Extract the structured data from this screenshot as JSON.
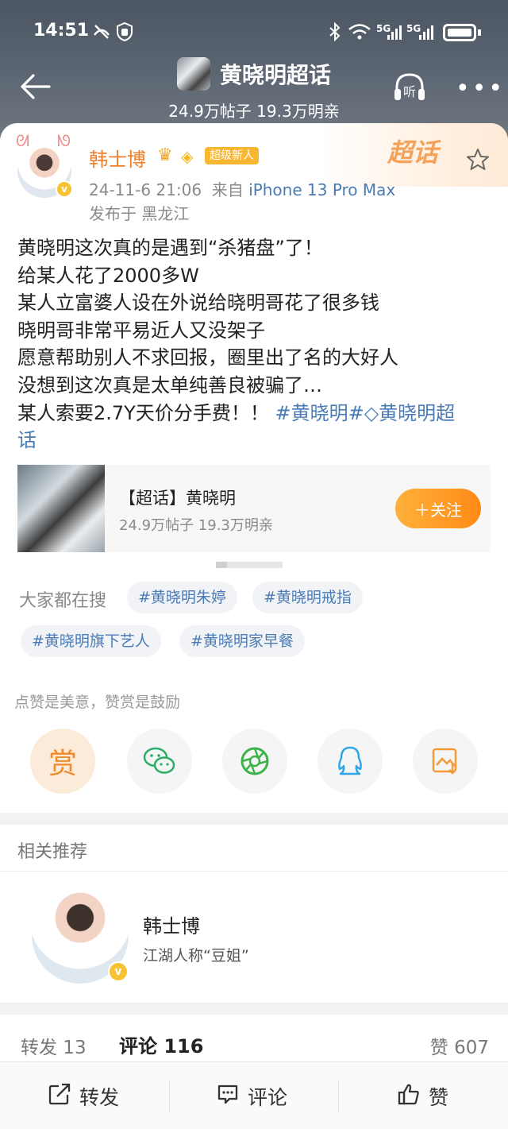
{
  "status_bar": {
    "time": "14:51",
    "network1": "5G",
    "network2": "5G"
  },
  "header": {
    "title": "黄晓明超话",
    "subtitle": "24.9万帖子 19.3万明亲",
    "listen_label": "听"
  },
  "post": {
    "badge": "超话",
    "author": "韩士博",
    "level_badge": "超级新人",
    "date": "24-11-6 21:06",
    "source_prefix": "来自",
    "device": "iPhone 13 Pro Max",
    "location": "发布于 黑龙江",
    "lines": [
      "黄晓明这次真的是遇到“杀猪盘”了！",
      "给某人花了2000多W",
      "某人立富婆人设在外说给晓明哥花了很多钱",
      "晓明哥非常平易近人又没架子",
      "愿意帮助别人不求回报，圈里出了名的大好人",
      "没想到这次真是太单纯善良被骗了…",
      "某人索要2.7Y天价分手费！！"
    ],
    "tag1": "#黄晓明#",
    "tag2": "黄晓明超",
    "tag2_cont": "话"
  },
  "topic_card": {
    "title": "【超话】黄晓明",
    "subtitle": "24.9万帖子 19.3万明亲",
    "follow_label": "＋关注"
  },
  "search": {
    "label": "大家都在搜",
    "chips": [
      "#黄晓明朱婷",
      "#黄晓明戒指",
      "#黄晓明旗下艺人",
      "#黄晓明家早餐"
    ]
  },
  "reward": {
    "note": "点赞是美意，赞赏是鼓励",
    "reward_label": "赏"
  },
  "related": {
    "title": "相关推荐",
    "name": "韩士博",
    "desc": "江湖人称“豆姐”"
  },
  "stats": {
    "repost": "转发 13",
    "comment": "评论 116",
    "like": "赞 607"
  },
  "bottom_bar": {
    "repost": "转发",
    "comment": "评论",
    "like": "赞"
  },
  "colors": {
    "accent_orange": "#ff8a16",
    "link_blue": "#4a7bb5",
    "username_orange": "#f07f2a"
  }
}
